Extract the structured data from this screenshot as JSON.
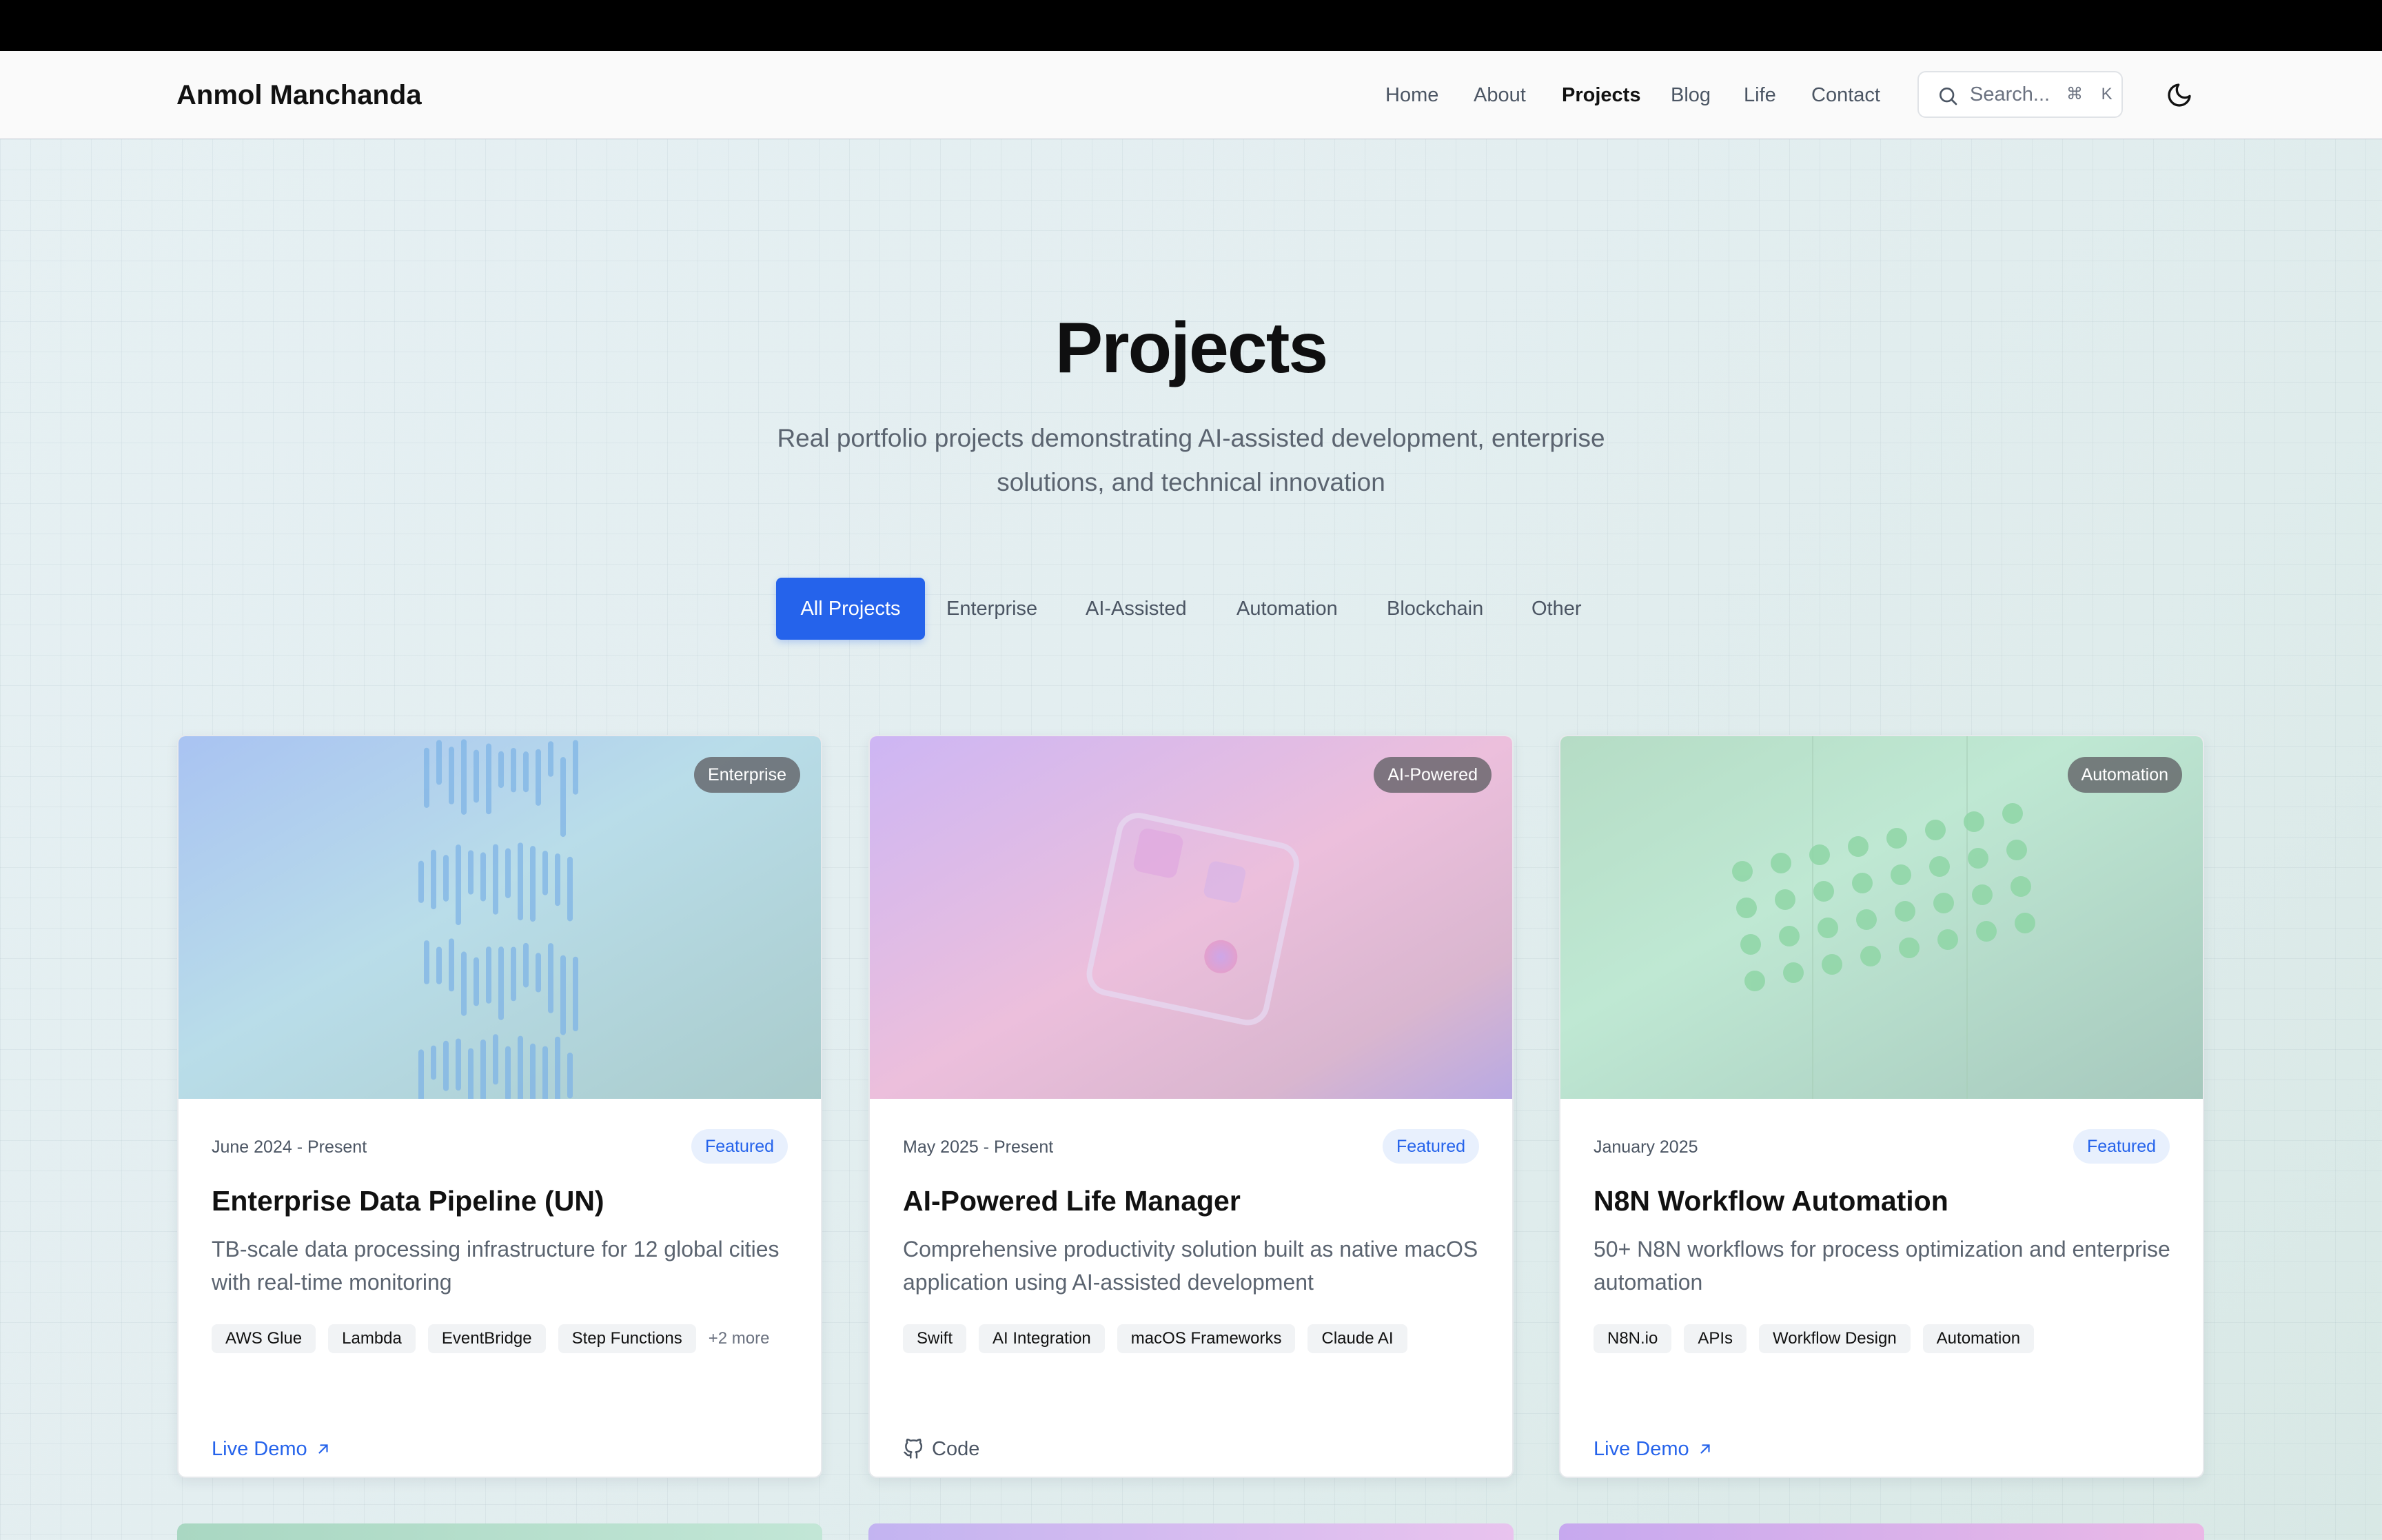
{
  "header": {
    "brand": "Anmol Manchanda",
    "nav": [
      {
        "label": "Home"
      },
      {
        "label": "About"
      },
      {
        "label": "Projects",
        "active": true
      },
      {
        "label": "Blog"
      },
      {
        "label": "Life"
      },
      {
        "label": "Contact"
      }
    ],
    "search": {
      "placeholder": "Search...",
      "shortcut": "⌘ K"
    }
  },
  "hero": {
    "title": "Projects",
    "subtitle": "Real portfolio projects demonstrating AI-assisted development, enterprise solutions, and technical innovation"
  },
  "filters": [
    {
      "label": "All Projects",
      "active": true
    },
    {
      "label": "Enterprise"
    },
    {
      "label": "AI-Assisted"
    },
    {
      "label": "Automation"
    },
    {
      "label": "Blockchain"
    },
    {
      "label": "Other"
    }
  ],
  "projects": [
    {
      "category": "Enterprise",
      "date": "June 2024 - Present",
      "featured": "Featured",
      "title": "Enterprise Data Pipeline (UN)",
      "description": "TB-scale data processing infrastructure for 12 global cities with real-time monitoring",
      "tags": [
        "AWS Glue",
        "Lambda",
        "EventBridge",
        "Step Functions"
      ],
      "more": "+2 more",
      "action": "Live Demo"
    },
    {
      "category": "AI-Powered",
      "date": "May 2025 - Present",
      "featured": "Featured",
      "title": "AI-Powered Life Manager",
      "description": "Comprehensive productivity solution built as native macOS application using AI-assisted development",
      "tags": [
        "Swift",
        "AI Integration",
        "macOS Frameworks",
        "Claude AI"
      ],
      "action": "Code"
    },
    {
      "category": "Automation",
      "date": "January 2025",
      "featured": "Featured",
      "title": "N8N Workflow Automation",
      "description": "50+ N8N workflows for process optimization and enterprise automation",
      "tags": [
        "N8N.io",
        "APIs",
        "Workflow Design",
        "Automation"
      ],
      "action": "Live Demo"
    }
  ]
}
